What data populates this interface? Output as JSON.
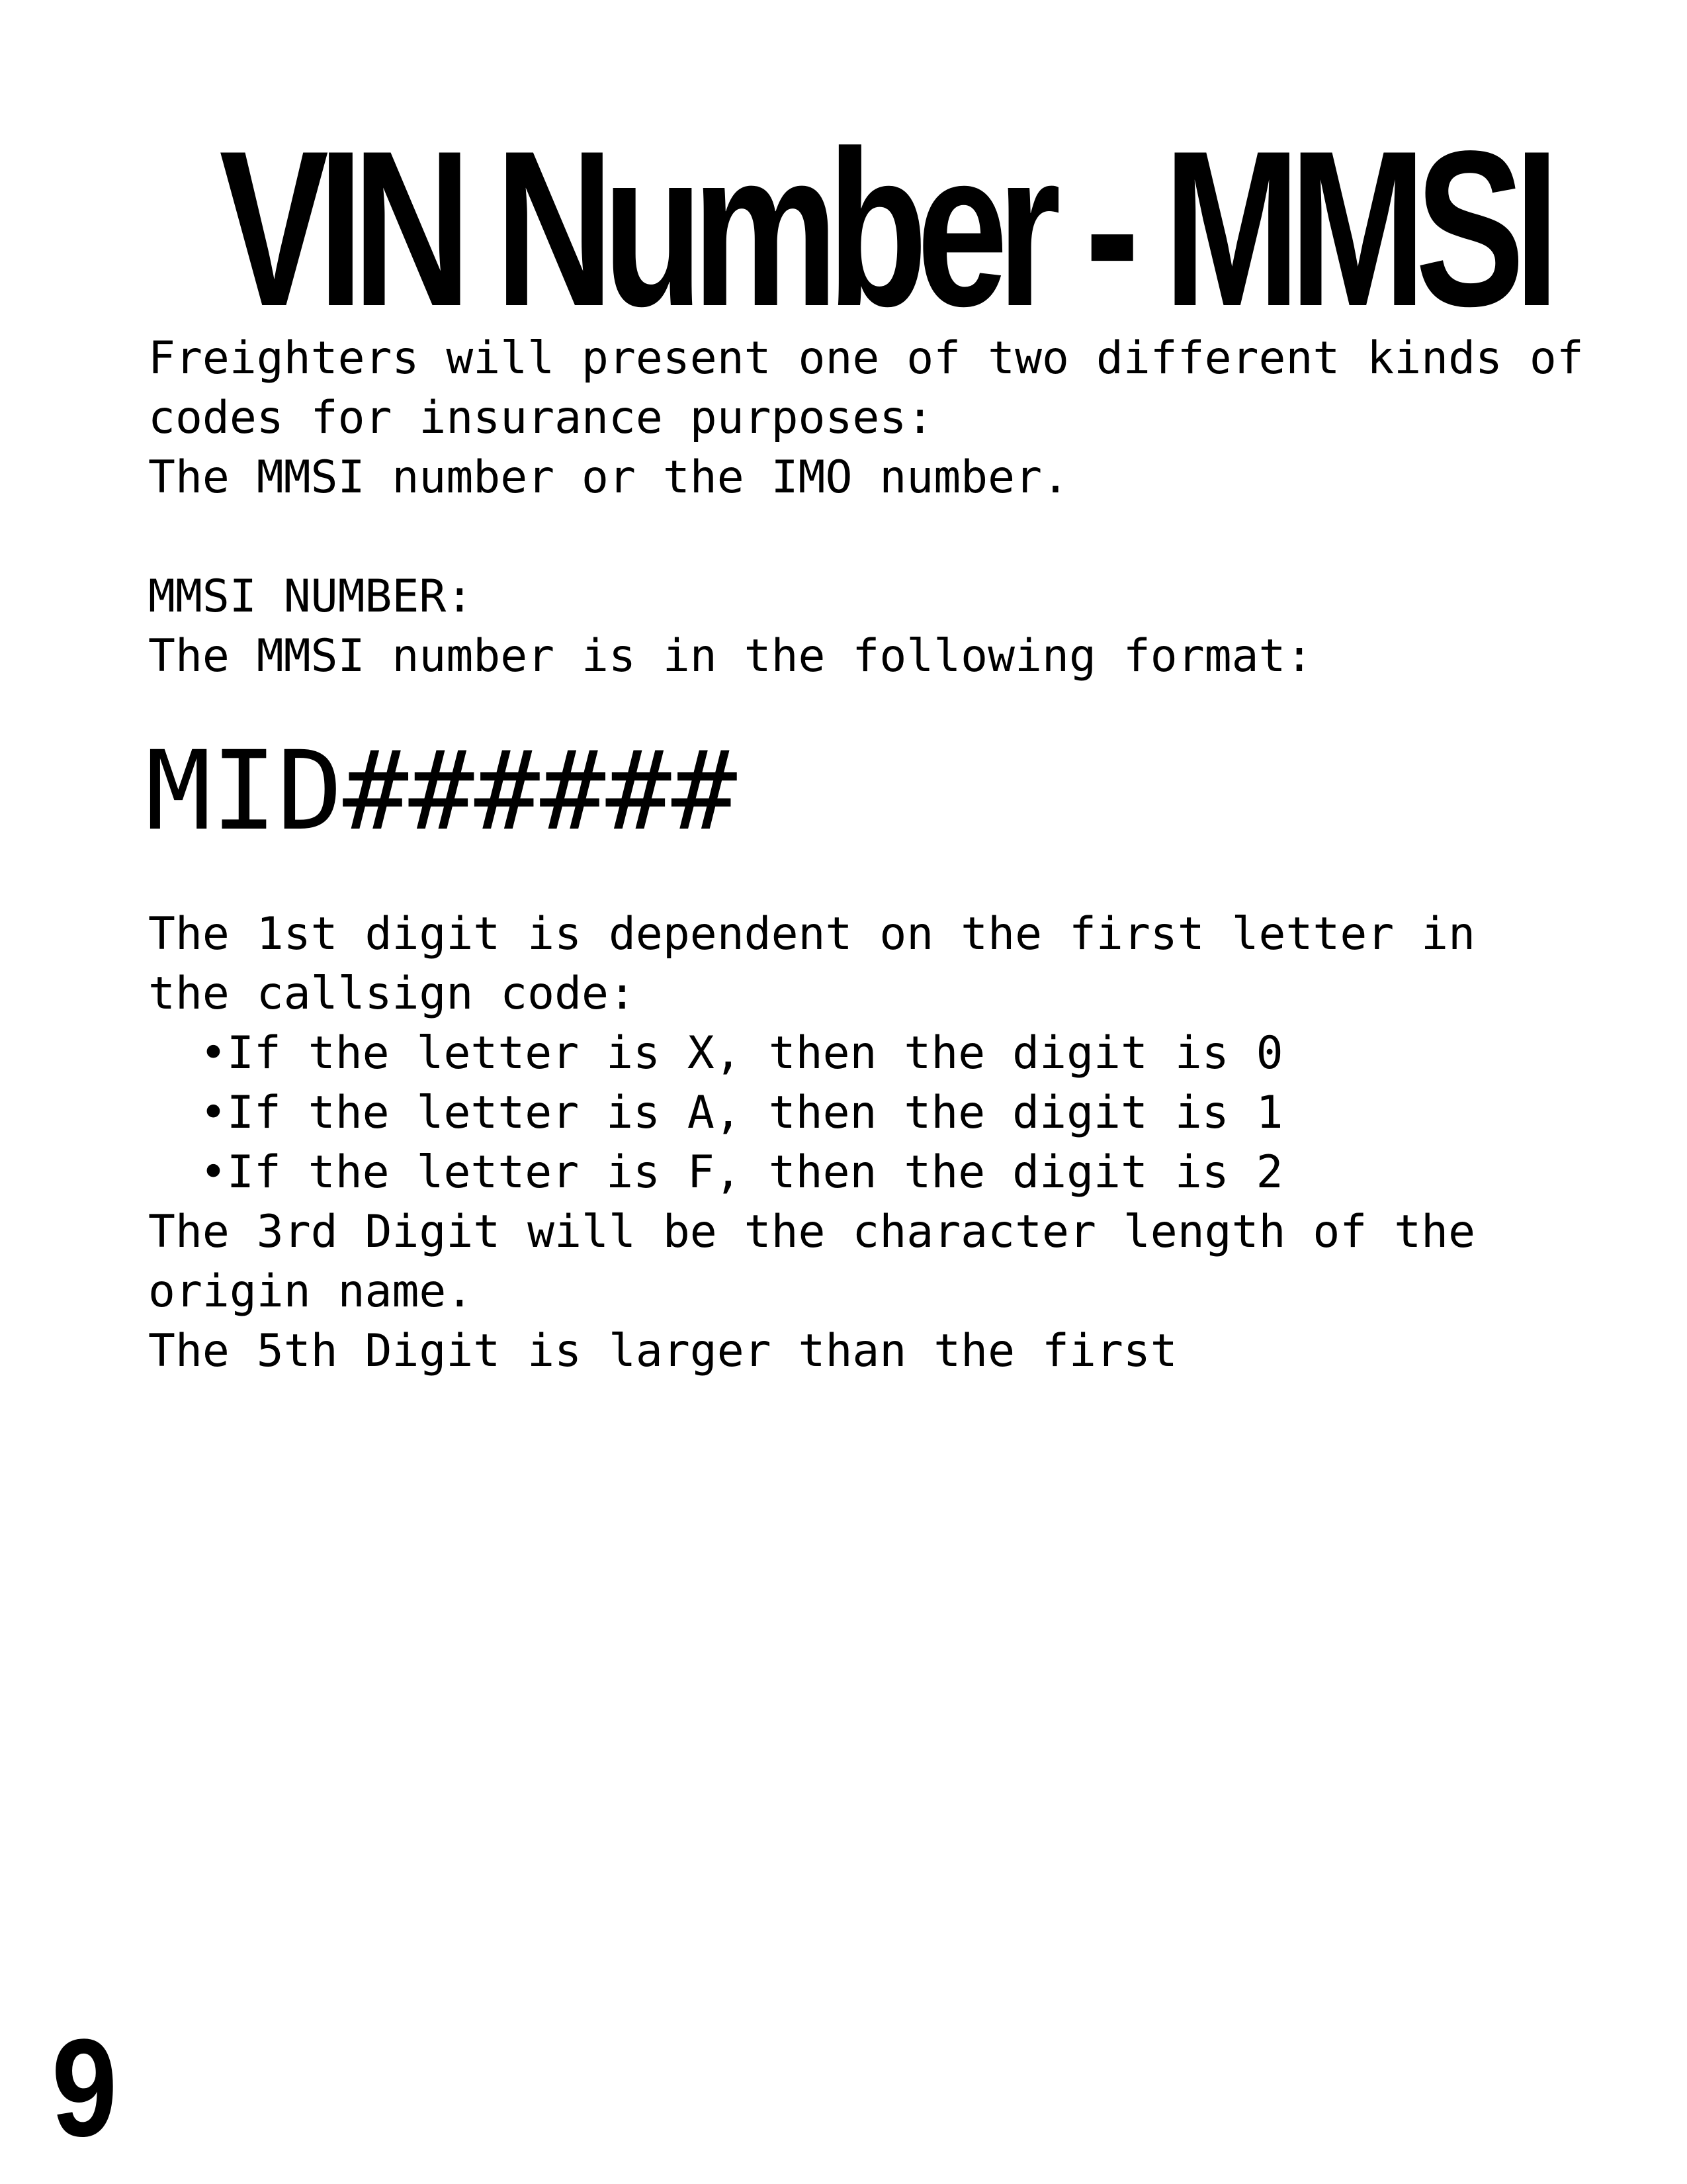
{
  "title": "VIN Number - MMSI",
  "intro": {
    "line1": "Freighters will present one of two different kinds of",
    "line2": "codes for insurance purposes:",
    "line3": "The MMSI number or the IMO number."
  },
  "mmsi_section": {
    "heading": "MMSI NUMBER:",
    "description": "The MMSI number is in the following format:",
    "format": "MID######"
  },
  "rules": {
    "first_digit_line1": "The 1st digit is dependent on the first letter in",
    "first_digit_line2": "the callsign code:",
    "bullets": [
      "•If the letter is X, then the digit is 0",
      "•If the letter is A, then the digit is 1",
      "•If the letter is F, then the digit is 2"
    ],
    "third_digit_line1": "The 3rd Digit will be the character length of the",
    "third_digit_line2": "origin name.",
    "fifth_digit": "The 5th Digit is larger than the first"
  },
  "page_number": "9"
}
